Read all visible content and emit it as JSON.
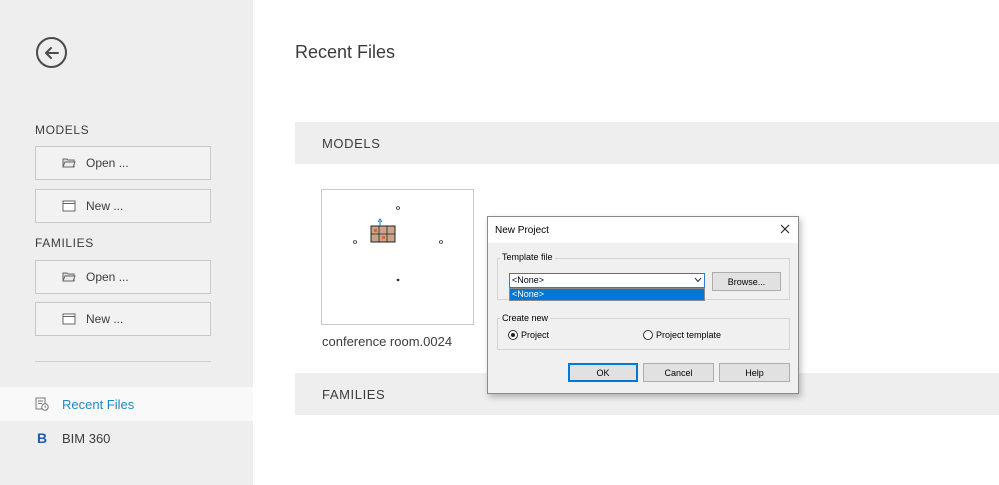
{
  "sidebar": {
    "back_icon": "arrow-left-circle-icon",
    "models_heading": "MODELS",
    "models_open_label": "Open ...",
    "models_new_label": "New ...",
    "families_heading": "FAMILIES",
    "families_open_label": "Open ...",
    "families_new_label": "New ...",
    "nav": [
      {
        "label": "Recent Files",
        "icon": "recent-files-icon",
        "active": true
      },
      {
        "label": "BIM 360",
        "icon": "bim360-icon",
        "active": false
      }
    ],
    "bim_letter": "B"
  },
  "main": {
    "title": "Recent Files",
    "models_section": "MODELS",
    "families_section": "FAMILIES",
    "recent_models": [
      {
        "name": "conference room.0024"
      }
    ]
  },
  "dialog": {
    "title": "New Project",
    "template_group": "Template file",
    "template_value": "<None>",
    "template_options": [
      "<None>"
    ],
    "browse_label": "Browse...",
    "create_group": "Create new",
    "radio_project": "Project",
    "radio_template": "Project template",
    "selected": "Project",
    "ok_label": "OK",
    "cancel_label": "Cancel",
    "help_label": "Help"
  },
  "colors": {
    "accent": "#1d8ac7",
    "sidebar_bg": "#eeeeee",
    "selection": "#0078d7"
  }
}
